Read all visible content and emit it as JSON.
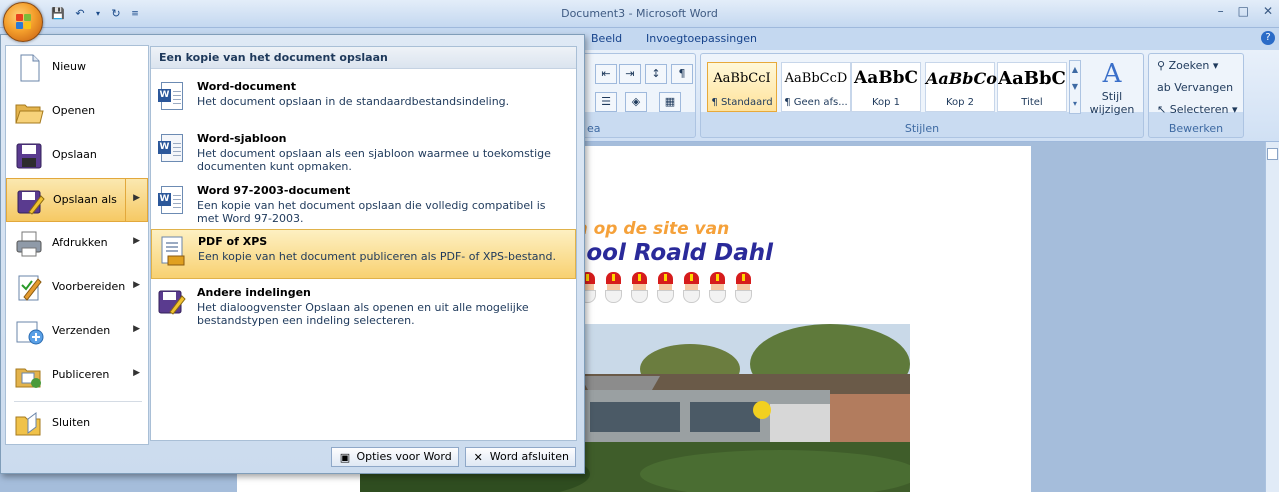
{
  "window": {
    "title": "Document3 - Microsoft Word",
    "controls": [
      "–",
      "□",
      "✕"
    ]
  },
  "ribbon": {
    "tabs": [
      "Beeld",
      "Invoegtoepassingen"
    ],
    "alinea_label": "ea",
    "styles_group": "Stijlen",
    "styles": [
      {
        "sample": "AaBbCcI",
        "name": "¶ Standaard"
      },
      {
        "sample": "AaBbCcD",
        "name": "¶ Geen afs..."
      },
      {
        "sample": "AaBbC",
        "name": "Kop 1"
      },
      {
        "sample": "AaBbCo",
        "name": "Kop 2"
      },
      {
        "sample": "AaBbC",
        "name": "Titel"
      }
    ],
    "change_styles": "Stijl wijzigen",
    "edit_group": "Bewerken",
    "edit_items": [
      "Zoeken",
      "Vervangen",
      "Selecteren"
    ]
  },
  "menu": {
    "items": [
      {
        "label": "Nieuw",
        "icon": "new-document-icon",
        "arrow": false
      },
      {
        "label": "Openen",
        "icon": "open-folder-icon",
        "arrow": false
      },
      {
        "label": "Opslaan",
        "icon": "save-disk-icon",
        "arrow": false
      },
      {
        "label": "Opslaan als",
        "icon": "save-as-icon",
        "arrow": true
      },
      {
        "label": "Afdrukken",
        "icon": "printer-icon",
        "arrow": true
      },
      {
        "label": "Voorbereiden",
        "icon": "prepare-icon",
        "arrow": true
      },
      {
        "label": "Verzenden",
        "icon": "send-icon",
        "arrow": true
      },
      {
        "label": "Publiceren",
        "icon": "publish-icon",
        "arrow": true
      },
      {
        "label": "Sluiten",
        "icon": "close-folder-icon",
        "arrow": false
      }
    ],
    "submenu_header": "Een kopie van het document opslaan",
    "submenu": [
      {
        "title": "Word-document",
        "desc": "Het document opslaan in de standaardbestandsindeling."
      },
      {
        "title": "Word-sjabloon",
        "desc": "Het document opslaan als een sjabloon waarmee u toekomstige documenten kunt opmaken."
      },
      {
        "title": "Word 97-2003-document",
        "desc": "Een kopie van het document opslaan die volledig compatibel is met Word 97-2003."
      },
      {
        "title": "PDF of XPS",
        "desc": "Een kopie van het document publiceren als PDF- of XPS-bestand."
      },
      {
        "title": "Andere indelingen",
        "desc": "Het dialoogvenster Opslaan als openen en uit alle mogelijke bestandstypen een indeling selecteren."
      }
    ],
    "footer": {
      "options": "Opties voor Word",
      "exit": "Word afsluiten"
    }
  },
  "document": {
    "line1": "m op de site van",
    "line2": "hool Roald Dahl"
  }
}
